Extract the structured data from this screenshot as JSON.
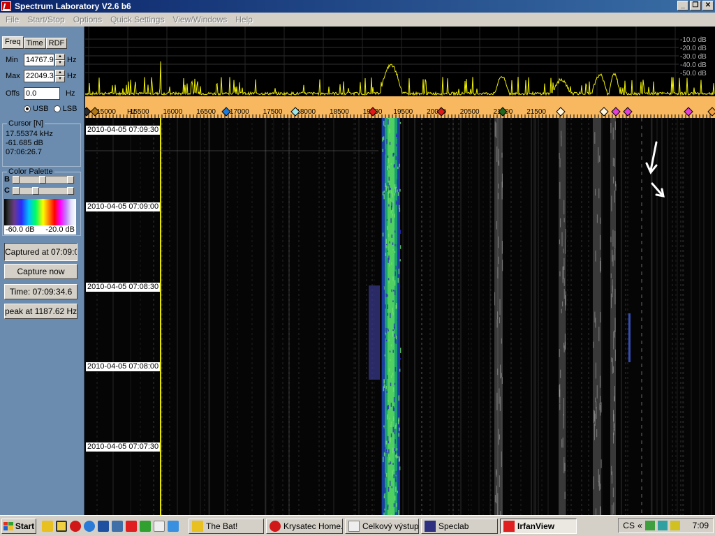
{
  "window": {
    "title": "Spectrum Laboratory V2.6 b6"
  },
  "menu": [
    "File",
    "Start/Stop",
    "Options",
    "Quick Settings",
    "View/Windows",
    "Help"
  ],
  "left": {
    "tabs": [
      "Freq",
      "Time",
      "RDF"
    ],
    "min_label": "Min",
    "min_value": "14767.9",
    "max_label": "Max",
    "max_value": "22049.3",
    "offs_label": "Offs",
    "offs_value": "0.0",
    "unit": "Hz",
    "usb": "USB",
    "lsb": "LSB",
    "cursor_title": "Cursor [N]",
    "cursor_freq": "17.55374 kHz",
    "cursor_level": "-61.685 dB",
    "cursor_time": "07:06:26.7",
    "palette_title": "Color Palette",
    "b_label": "B",
    "c_label": "C",
    "palette_min": "-60.0 dB",
    "palette_max": "-20.0 dB",
    "captured": "Captured at 07:09:0",
    "capture_now": "Capture now",
    "time": "Time:  07:09:34.6",
    "peak": "peak at 1187.62 Hz"
  },
  "spectrum": {
    "db_labels": [
      "-10.0 dB",
      "-20.0 dB",
      "-30.0 dB",
      "-40.0 dB",
      "-50.0 dB"
    ],
    "freq_labels": [
      "15000",
      "15500",
      "16000",
      "16500",
      "17000",
      "17500",
      "18000",
      "18500",
      "19000",
      "19500",
      "20000",
      "20500",
      "21000",
      "21500"
    ],
    "freq_unit": "Hz",
    "marker_colors": [
      "#2a2a2a",
      "#b07818",
      "#1e7ad8",
      "#9ee8e8",
      "#e01818",
      "#e01818",
      "#206820",
      "#fff4d8",
      "#fff4d8",
      "#e040d8",
      "#e040d8",
      "#e040d8",
      "#f0a040"
    ]
  },
  "waterfall": {
    "timestamps": [
      "2010-04-05 07:09:30",
      "2010-04-05 07:09:00",
      "2010-04-05 07:08:30",
      "2010-04-05 07:08:00",
      "2010-04-05 07:07:30"
    ]
  },
  "taskbar": {
    "start": "Start",
    "tasks": [
      "The Bat!",
      "Krysatec Home...",
      "Celkový výstup",
      "Speclab",
      "IrfanView"
    ],
    "active_task": "IrfanView",
    "tray_prefix": "CS",
    "clock": "7:09"
  }
}
